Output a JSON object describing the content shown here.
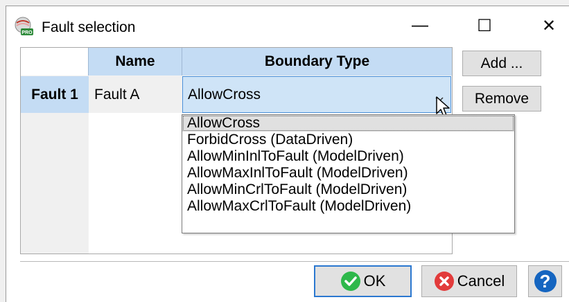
{
  "window": {
    "title": "Fault selection",
    "minimize_glyph": "—",
    "maximize_glyph": "☐",
    "close_glyph": "✕",
    "app_icon": "pro-app-icon"
  },
  "grid": {
    "columns": [
      "Name",
      "Boundary Type"
    ],
    "rows": [
      {
        "header": "Fault 1",
        "name": "Fault A",
        "boundary_type": "AllowCross"
      }
    ]
  },
  "dropdown": {
    "options": [
      "AllowCross",
      "ForbidCross (DataDriven)",
      "AllowMinInlToFault (ModelDriven)",
      "AllowMaxInlToFault (ModelDriven)",
      "AllowMinCrlToFault (ModelDriven)",
      "AllowMaxCrlToFault (ModelDriven)"
    ],
    "selected": "AllowCross"
  },
  "buttons": {
    "add": "Add ...",
    "remove": "Remove",
    "ok": "OK",
    "cancel": "Cancel",
    "help": "?"
  },
  "colors": {
    "header_blue": "#c4dcf4",
    "selection_blue": "#cfe4f7",
    "ok_green": "#2eb84b",
    "cancel_red": "#e23b3b",
    "help_blue": "#1565c0"
  }
}
